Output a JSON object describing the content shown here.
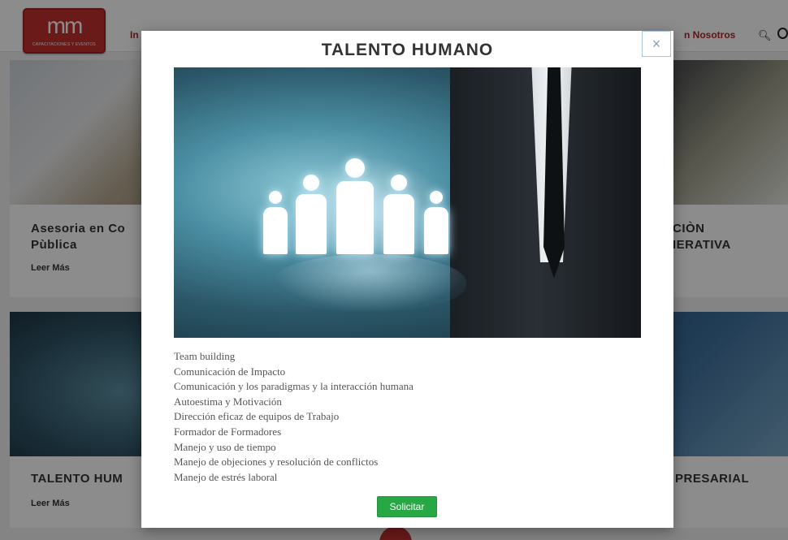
{
  "header": {
    "logo": {
      "mark": "mm",
      "subtitle": "CAPACITACIONES Y EVENTOS"
    },
    "nav_left_fragment": "In",
    "nav_right_fragment": "n Nosotros",
    "search_icon": "search-icon",
    "lang_icon": "globe-icon"
  },
  "cards": [
    {
      "title_line1": "Asesoria en Co",
      "title_line2": "Pùblica",
      "more": "Leer Más"
    },
    {
      "title_line1": "TALENTO HUM",
      "more": "Leer Más"
    },
    {
      "title_line1": "CIÒN",
      "title_line2": "IERATIVA"
    },
    {
      "title_line1": "PRESARIAL"
    }
  ],
  "modal": {
    "title": "TALENTO HUMANO",
    "close_label": "×",
    "items": [
      "Team building",
      "Comunicación de Impacto",
      "Comunicación y los paradigmas y la interacción humana",
      "Autoestima y Motivación",
      "Dirección eficaz de equipos de Trabajo",
      "Formador de Formadores",
      "Manejo y uso de tiempo",
      "Manejo de objeciones y resolución de conflictos",
      "Manejo de estrés laboral"
    ],
    "button_label": "Solicitar"
  },
  "colors": {
    "brand_red": "#c0302e",
    "button_green": "#28a745",
    "overlay": "rgba(0,0,0,0.45)"
  }
}
